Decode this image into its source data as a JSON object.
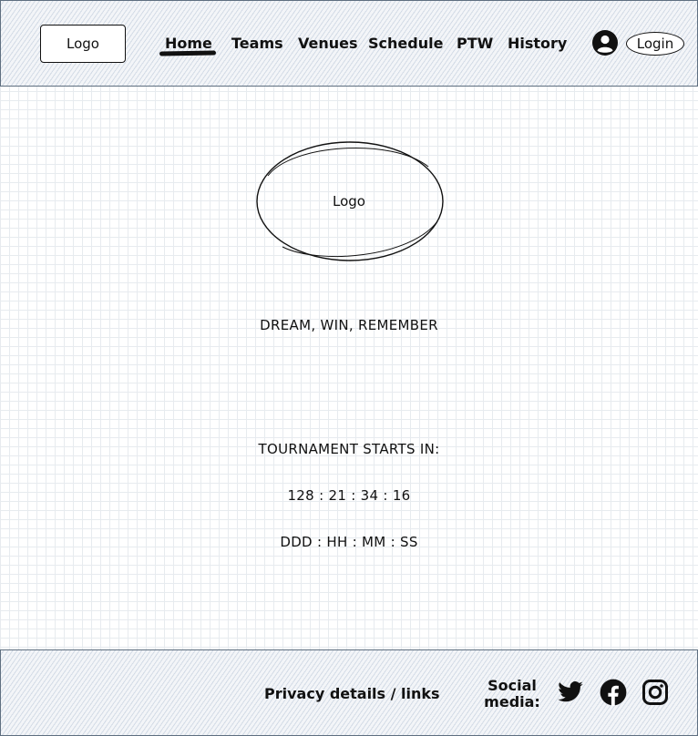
{
  "header": {
    "logo_label": "Logo",
    "nav": [
      "Home",
      "Teams",
      "Venues",
      "Schedule",
      "PTW",
      "History"
    ],
    "active_nav": "Home",
    "login_label": "Login"
  },
  "hero": {
    "logo_label": "Logo",
    "tagline": "DREAM, WIN, REMEMBER"
  },
  "countdown": {
    "heading": "TOURNAMENT STARTS IN:",
    "value": "128 : 21 : 34 : 16",
    "format": "DDD : HH : MM : SS"
  },
  "footer": {
    "privacy_label": "Privacy details / links",
    "social_label_1": "Social",
    "social_label_2": "media:",
    "social_icons": [
      "twitter-icon",
      "facebook-icon",
      "instagram-icon"
    ]
  },
  "colors": {
    "ink": "#111111",
    "hatch": "#d3dbe6",
    "border": "#5f6f80"
  }
}
